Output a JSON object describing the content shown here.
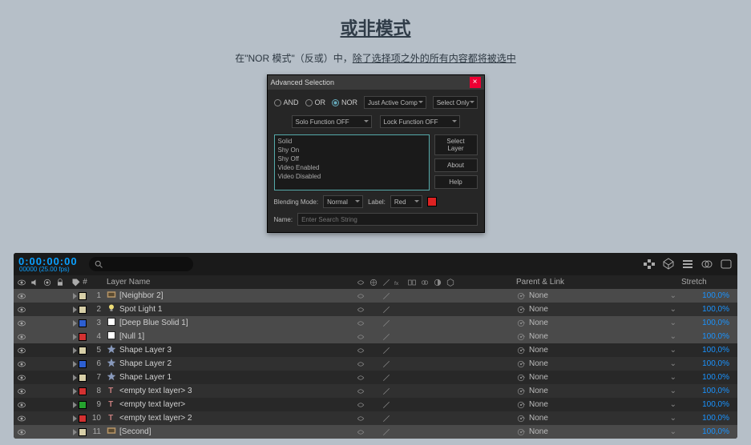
{
  "banner": {
    "title": "或非模式",
    "sub_pre": "在\"NOR 模式\"（反或）中，",
    "sub_u": "除了选择项之外的所有内容都将被选中"
  },
  "dialog": {
    "title": "Advanced Selection",
    "radios": {
      "and": "AND",
      "or": "OR",
      "nor": "NOR",
      "selected": "nor"
    },
    "comp_dd": "Just Active Comp",
    "select_dd": "Select Only",
    "solo_dd": "Solo Function OFF",
    "lock_dd": "Lock Function OFF",
    "list": [
      "Solid",
      "Shy On",
      "Shy Off",
      "Video Enabled",
      "Video Disabled"
    ],
    "btn_select": "Select Layer",
    "btn_about": "About",
    "btn_help": "Help",
    "blend_label": "Blending Mode:",
    "blend_mode": "Normal",
    "label_label": "Label:",
    "label_val": "Red",
    "name_label": "Name:",
    "name_placeholder": "Enter Search String"
  },
  "timeline": {
    "timecode": "0:00:00:00",
    "timecode_sub": "00000 (25.00 fps)",
    "head": {
      "name": "Layer Name",
      "parent": "Parent & Link",
      "stretch": "Stretch"
    },
    "rows": [
      {
        "n": 1,
        "color": "#d7cfa8",
        "icon": "comp",
        "name": "[Neighbor 2]",
        "sel": true,
        "parent": "None",
        "stretch": "100,0%"
      },
      {
        "n": 2,
        "color": "#d7cfa8",
        "icon": "light",
        "name": "Spot Light 1",
        "sel": false,
        "parent": "None",
        "stretch": "100,0%"
      },
      {
        "n": 3,
        "color": "#2d5fd1",
        "icon": "solid",
        "name": "[Deep Blue Solid 1]",
        "sel": true,
        "parent": "None",
        "stretch": "100,0%"
      },
      {
        "n": 4,
        "color": "#d33131",
        "icon": "solid",
        "name": "[Null 1]",
        "sel": true,
        "parent": "None",
        "stretch": "100,0%"
      },
      {
        "n": 5,
        "color": "#d7cfa8",
        "icon": "star",
        "name": "Shape Layer 3",
        "sel": false,
        "parent": "None",
        "stretch": "100,0%"
      },
      {
        "n": 6,
        "color": "#2d5fd1",
        "icon": "star",
        "name": "Shape Layer 2",
        "sel": false,
        "parent": "None",
        "stretch": "100,0%"
      },
      {
        "n": 7,
        "color": "#d7cfa8",
        "icon": "star",
        "name": "Shape Layer 1",
        "sel": false,
        "parent": "None",
        "stretch": "100,0%"
      },
      {
        "n": 8,
        "color": "#d33131",
        "icon": "text",
        "name": "<empty text layer> 3",
        "sel": false,
        "parent": "None",
        "stretch": "100,0%"
      },
      {
        "n": 9,
        "color": "#25a22e",
        "icon": "text",
        "name": "<empty text layer>",
        "sel": false,
        "parent": "None",
        "stretch": "100,0%"
      },
      {
        "n": 10,
        "color": "#d33131",
        "icon": "text",
        "name": "<empty text layer> 2",
        "sel": false,
        "parent": "None",
        "stretch": "100,0%"
      },
      {
        "n": 11,
        "color": "#d7cfa8",
        "icon": "comp",
        "name": "[Second]",
        "sel": true,
        "parent": "None",
        "stretch": "100,0%"
      }
    ]
  }
}
